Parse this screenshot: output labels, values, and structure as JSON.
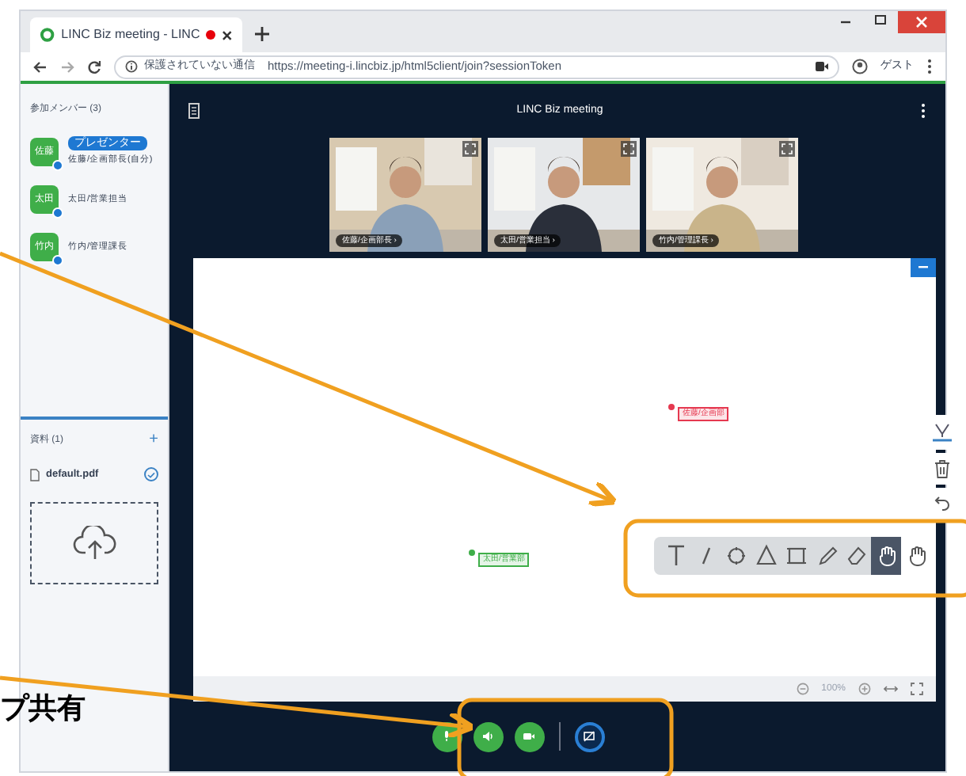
{
  "browser": {
    "tab_title": "LINC Biz meeting - LINC",
    "security": "保護されていない通信",
    "url": "https://meeting-i.lincbiz.jp/html5client/join?sessionToken",
    "profile": "ゲスト"
  },
  "sidebar": {
    "members_header": "参加メンバー (3)",
    "members": [
      {
        "initials": "佐藤",
        "name": "佐藤/企画部長(自分)",
        "badge": "プレゼンター"
      },
      {
        "initials": "太田",
        "name": "太田/営業担当"
      },
      {
        "initials": "竹内",
        "name": "竹内/管理課長"
      }
    ],
    "documents_header": "資料 (1)",
    "add": "+",
    "documents": [
      {
        "name": "default.pdf",
        "checked": true
      }
    ]
  },
  "main": {
    "title": "LINC Biz meeting",
    "videos": [
      {
        "label": "佐藤/企画部長 ›",
        "kind": "picture"
      },
      {
        "label": "太田/営業担当 ›",
        "kind": "picture"
      },
      {
        "label": "竹内/管理課長 ›",
        "kind": "picture"
      }
    ],
    "cursors": [
      {
        "label": "佐藤/企画部",
        "color": "#e53950"
      },
      {
        "label": "太田/営業部",
        "color": "#3fae49"
      }
    ],
    "zoom": "100%",
    "tools": [
      {
        "kind": "text",
        "selected": false
      },
      {
        "kind": "line",
        "selected": false
      },
      {
        "kind": "ellipse",
        "selected": false
      },
      {
        "kind": "triangle",
        "selected": false
      },
      {
        "kind": "rectangle",
        "selected": false
      },
      {
        "kind": "pencil",
        "selected": false
      },
      {
        "kind": "eraser",
        "selected": false
      },
      {
        "kind": "hand",
        "selected": true
      },
      {
        "kind": "hand",
        "selected": false
      }
    ],
    "controls": [
      {
        "kind": "mic"
      },
      {
        "kind": "speaker"
      },
      {
        "kind": "camera"
      },
      {
        "kind": "screen"
      }
    ]
  },
  "annotation": {
    "caption": "プ共有"
  }
}
